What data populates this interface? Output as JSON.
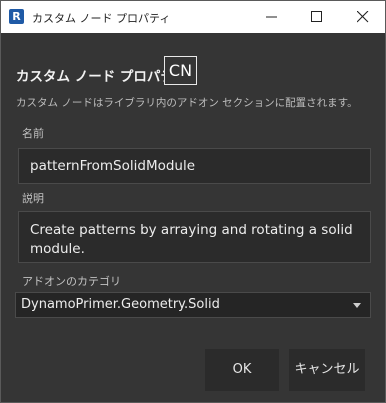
{
  "window": {
    "title": "カスタム ノード プロパティ",
    "icon_letter": "R"
  },
  "header": {
    "title": "カスタム ノード プロパティ",
    "badge": "CN",
    "description": "カスタム ノードはライブラリ内のアドオン セクションに配置されます。"
  },
  "form": {
    "name_label": "名前",
    "name_value": "patternFromSolidModule",
    "description_label": "説明",
    "description_value": "Create patterns by arraying and rotating a solid module.",
    "category_label": "アドオンのカテゴリ",
    "category_value": "DynamoPrimer.Geometry.Solid"
  },
  "buttons": {
    "ok": "OK",
    "cancel": "キャンセル"
  },
  "icons": {
    "app": "revit-icon",
    "minimize": "minimize-icon",
    "maximize": "maximize-icon",
    "close": "close-icon",
    "dropdown": "chevron-down-icon"
  }
}
